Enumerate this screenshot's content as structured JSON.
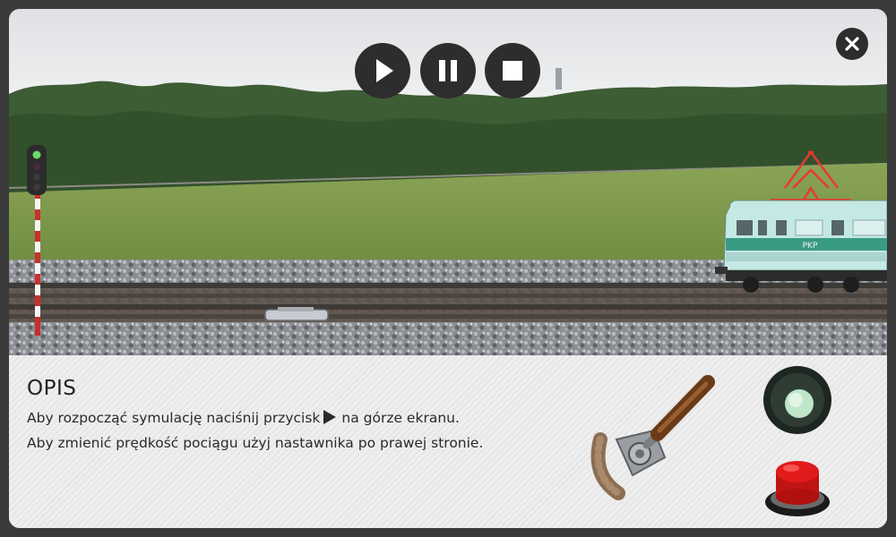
{
  "colors": {
    "frame": "#3a3a3a",
    "control_bg": "#2d2d2d",
    "sky": "#e4e6e8",
    "trees": "#3a5a32",
    "grass": "#7d9a4e",
    "train_body": "#b9e3df",
    "train_stripe": "#3a9b84",
    "pantograph": "#e83a2e",
    "signal_green": "#6ad86a",
    "lamp_green": "#bfe6c8",
    "stop_button_red": "#e11b1b"
  },
  "controls": {
    "play_icon": "play-icon",
    "pause_icon": "pause-icon",
    "stop_icon": "stop-icon",
    "close_icon": "close-icon"
  },
  "train": {
    "livery_label": "PKP"
  },
  "opis": {
    "title": "OPIS",
    "line1_before": "Aby rozpocząć symulację naciśnij przycisk",
    "line1_after": "na górze ekranu.",
    "line2": "Aby zmienić prędkość pociągu użyj nastawnika po prawej stronie."
  }
}
